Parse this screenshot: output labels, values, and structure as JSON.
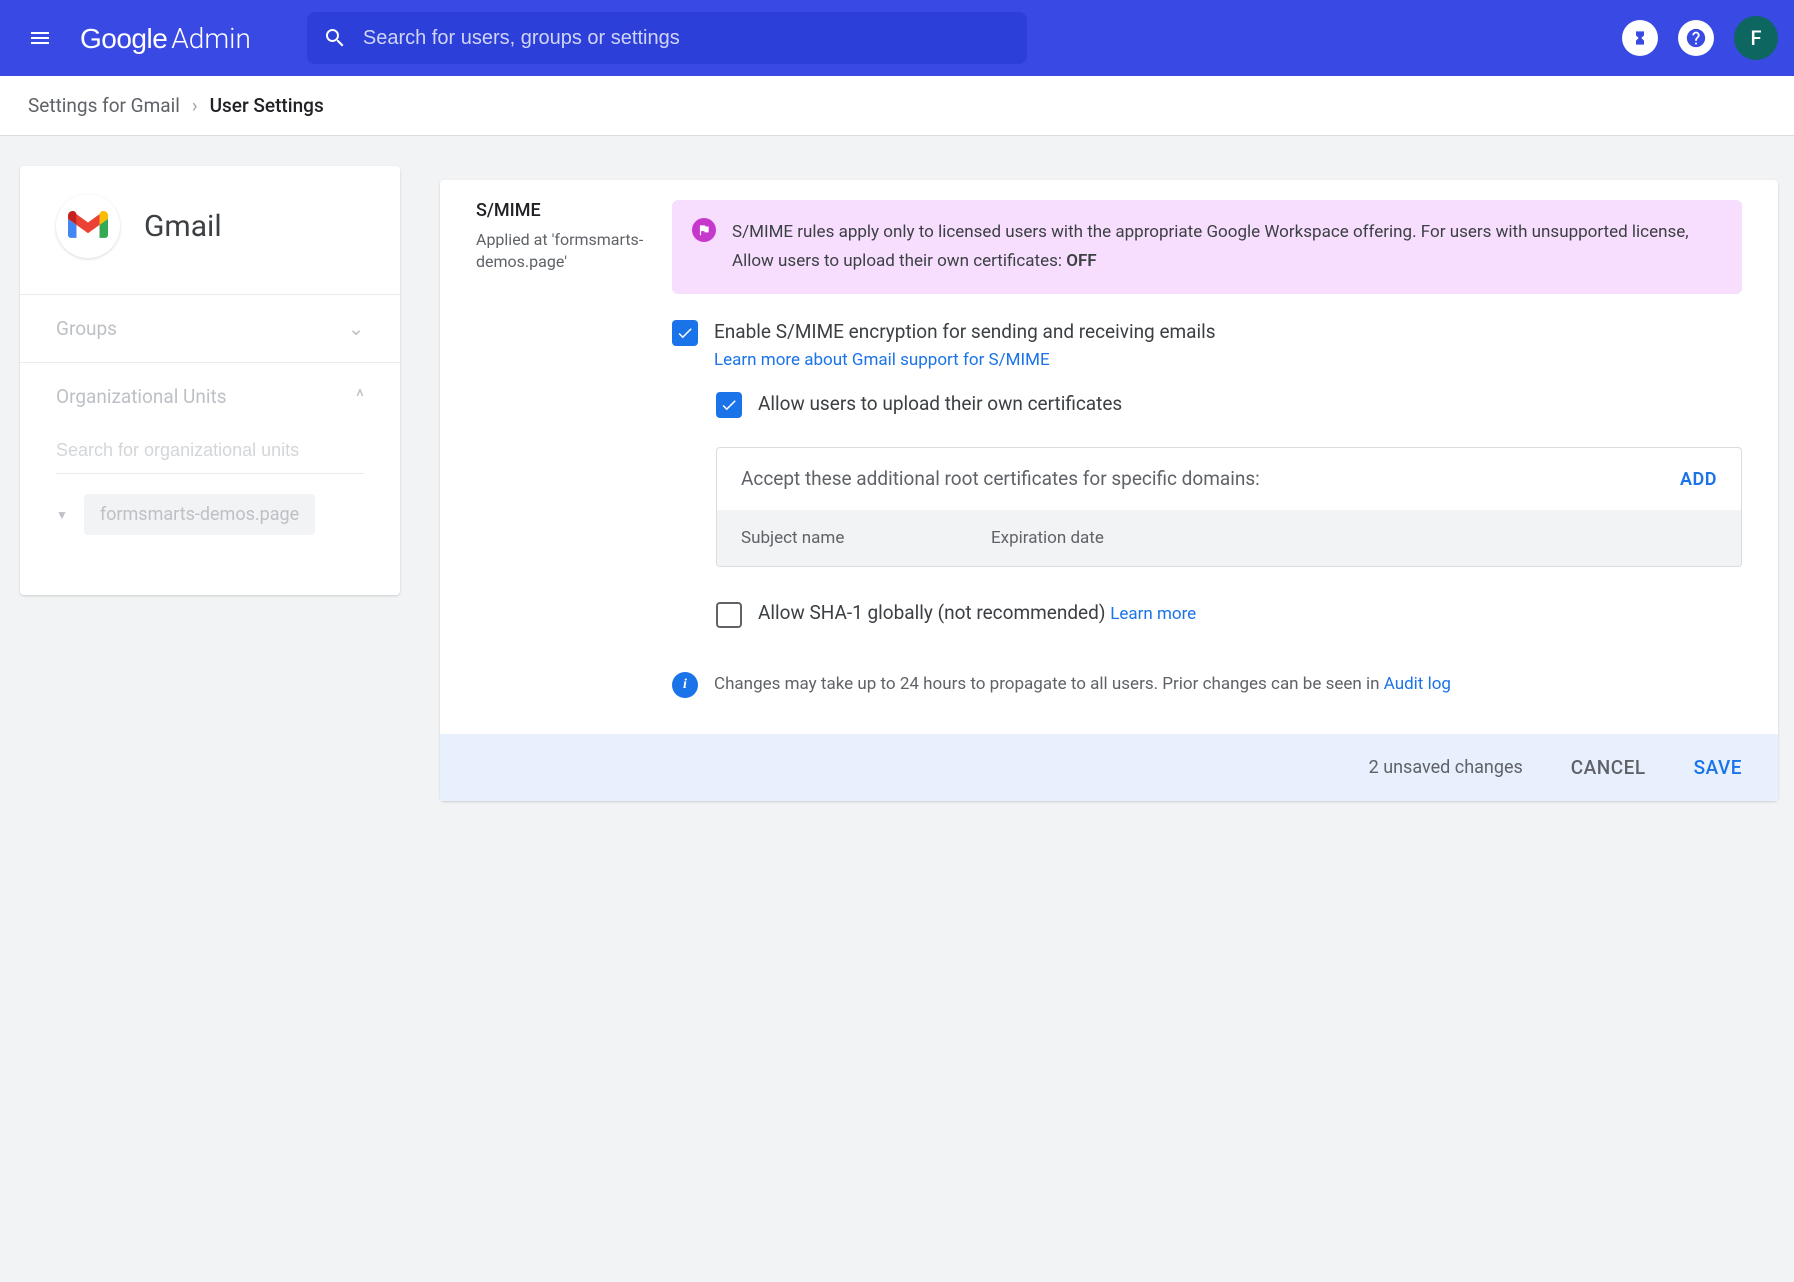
{
  "header": {
    "logo_google": "Google",
    "logo_admin": "Admin",
    "search_placeholder": "Search for users, groups or settings",
    "avatar_initial": "F"
  },
  "breadcrumb": {
    "parent": "Settings for Gmail",
    "current": "User Settings"
  },
  "sidebar": {
    "title": "Gmail",
    "groups_label": "Groups",
    "org_units_label": "Organizational Units",
    "org_search_placeholder": "Search for organizational units",
    "org_item": "formsmarts-demos.page"
  },
  "section": {
    "title": "S/MIME",
    "applied_at_prefix": "Applied at",
    "applied_at_value": "'formsmarts-demos.page'"
  },
  "notice": {
    "text": "S/MIME rules apply only to licensed users with the appropriate Google Workspace offering. For users with unsupported license, Allow users to upload their own certificates: ",
    "bold": "OFF"
  },
  "options": {
    "enable_label": "Enable S/MIME encryption for sending and receiving emails",
    "enable_learn": "Learn more about Gmail support for S/MIME",
    "upload_label": "Allow users to upload their own certificates",
    "sha1_label": "Allow SHA-1 globally (not recommended) ",
    "sha1_learn": "Learn more"
  },
  "cert_table": {
    "header": "Accept these additional root certificates for specific domains:",
    "add": "ADD",
    "col1": "Subject name",
    "col2": "Expiration date"
  },
  "info": {
    "text": "Changes may take up to 24 hours to propagate to all users. Prior changes can be seen in ",
    "link": "Audit log"
  },
  "footer": {
    "unsaved": "2 unsaved changes",
    "cancel": "CANCEL",
    "save": "SAVE"
  }
}
